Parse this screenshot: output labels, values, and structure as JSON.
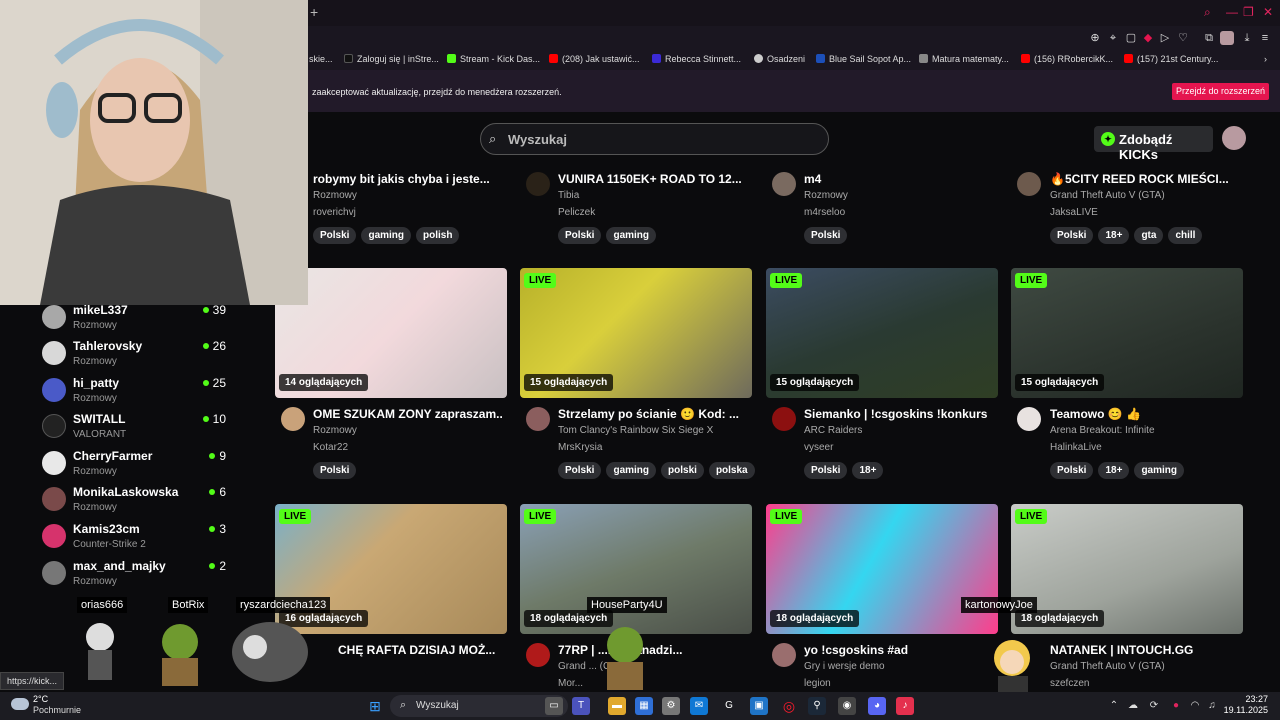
{
  "bookmarks": [
    {
      "label": "skie...",
      "color": "#777"
    },
    {
      "label": "Zaloguj się | inStre...",
      "color": "#111"
    },
    {
      "label": "Stream - Kick Das...",
      "color": "#53fc18"
    },
    {
      "label": "(208) Jak ustawić...",
      "color": "#ff0000"
    },
    {
      "label": "Rebecca Stinnett...",
      "color": "#3b2ad6"
    },
    {
      "label": "Osadzeni",
      "color": "#ccc"
    },
    {
      "label": "Blue Sail Sopot Ap...",
      "color": "#1c4fb8"
    },
    {
      "label": "Matura matematy...",
      "color": "#888"
    },
    {
      "label": "(156) RRobercikK...",
      "color": "#ff0000"
    },
    {
      "label": "(157) 21st Century...",
      "color": "#ff0000"
    }
  ],
  "notice": {
    "message": "zaakceptować aktualizację, przejdź do menedżera rozszerzeń.",
    "button": "Przejdź do rozszerzeń"
  },
  "search": {
    "placeholder": "Wyszukaj"
  },
  "kicks_button": "Zdobądź KICKs",
  "sidebar": [
    {
      "name": "mikeL337",
      "category": "Rozmowy",
      "viewers": "39"
    },
    {
      "name": "Tahlerovsky",
      "category": "Rozmowy",
      "viewers": "26"
    },
    {
      "name": "hi_patty",
      "category": "Rozmowy",
      "viewers": "25"
    },
    {
      "name": "SWITALL",
      "category": "VALORANT",
      "viewers": "10"
    },
    {
      "name": "CherryFarmer",
      "category": "Rozmowy",
      "viewers": "9"
    },
    {
      "name": "MonikaLaskowska",
      "category": "Rozmowy",
      "viewers": "6"
    },
    {
      "name": "Kamis23cm",
      "category": "Counter-Strike 2",
      "viewers": "3"
    },
    {
      "name": "max_and_majky",
      "category": "Rozmowy",
      "viewers": "2"
    }
  ],
  "row1": [
    {
      "title": "robymy bit jakis chyba i jeste...",
      "category": "Rozmowy",
      "user": "roverichvj",
      "tags": [
        "Polski",
        "gaming",
        "polish"
      ]
    },
    {
      "title": "VUNIRA 1150EK+ ROAD TO 12...",
      "category": "Tibia",
      "user": "Peliczek",
      "tags": [
        "Polski",
        "gaming"
      ]
    },
    {
      "title": "m4",
      "category": "Rozmowy",
      "user": "m4rseloo",
      "tags": [
        "Polski"
      ]
    },
    {
      "title": "🔥5CITY REED ROCK MIEŚCI...",
      "category": "Grand Theft Auto V (GTA)",
      "user": "JaksaLIVE",
      "tags": [
        "Polski",
        "18+",
        "gta",
        "chill"
      ]
    }
  ],
  "row2": [
    {
      "live": "",
      "viewers": "14 oglądających",
      "title": "OME SZUKAM ZONY zapraszam...",
      "category": "Rozmowy",
      "user": "Kotar22",
      "tags": [
        "Polski"
      ]
    },
    {
      "live": "LIVE",
      "viewers": "15 oglądających",
      "title": "Strzelamy po ścianie 🙂 Kod: ...",
      "category": "Tom Clancy's Rainbow Six Siege X",
      "user": "MrsKrysia",
      "tags": [
        "Polski",
        "gaming",
        "polski",
        "polska"
      ]
    },
    {
      "live": "LIVE",
      "viewers": "15 oglądających",
      "title": "Siemanko | !csgoskins !konkurs",
      "category": "ARC Raiders",
      "user": "vyseer",
      "tags": [
        "Polski",
        "18+"
      ]
    },
    {
      "live": "LIVE",
      "viewers": "15 oglądających",
      "title": "Teamowo 😊 👍",
      "category": "Arena Breakout: Infinite",
      "user": "HalinkaLive",
      "tags": [
        "Polski",
        "18+",
        "gaming"
      ]
    }
  ],
  "row3": [
    {
      "live": "LIVE",
      "viewers": "16 oglądających",
      "title": "CHĘ RAFTA DZISIAJ MOŻ...",
      "category": "",
      "user": ""
    },
    {
      "live": "LIVE",
      "viewers": "18 oglądających",
      "title": "77RP | ...kiś nanadzi...",
      "category": "Grand ... (GTA)",
      "user": "Mor..."
    },
    {
      "live": "LIVE",
      "viewers": "18 oglądających",
      "title": "yo !csgoskins #ad",
      "category": "Gry i wersje demo",
      "user": "legion"
    },
    {
      "live": "LIVE",
      "viewers": "18 oglądających",
      "title": "NATANEK | INTOUCH.GG",
      "category": "Grand Theft Auto V (GTA)",
      "user": "szefczen"
    }
  ],
  "overlay_names": [
    "orias666",
    "BotRix",
    "ryszardciecha123",
    "HouseParty4U",
    "kartonowyJoe"
  ],
  "status_url": "https://kick...",
  "taskbar": {
    "search_placeholder": "Wyszukaj",
    "temp": "2°C",
    "weather": "Pochmurnie",
    "time": "23:27",
    "date": "19.11.2025"
  }
}
